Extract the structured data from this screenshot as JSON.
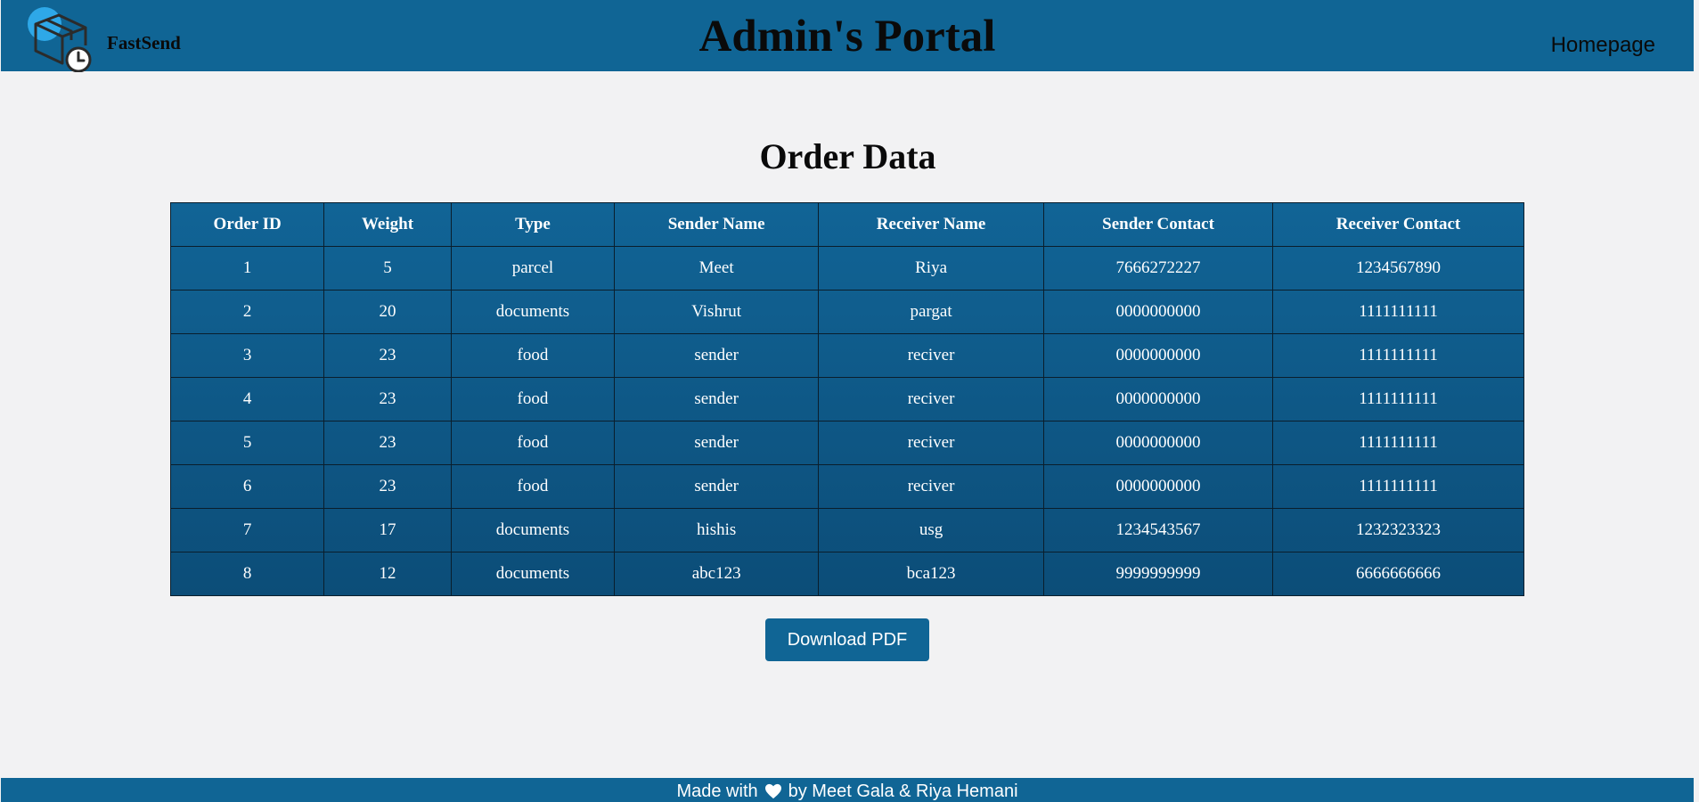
{
  "header": {
    "brand": "FastSend",
    "title": "Admin's Portal",
    "nav_link": "Homepage",
    "logo_icon": "package-clock-icon",
    "background": "#106595"
  },
  "main": {
    "section_title": "Order Data",
    "table": {
      "columns": [
        "Order ID",
        "Weight",
        "Type",
        "Sender Name",
        "Receiver Name",
        "Sender Contact",
        "Receiver Contact"
      ],
      "rows": [
        [
          "1",
          "5",
          "parcel",
          "Meet",
          "Riya",
          "7666272227",
          "1234567890"
        ],
        [
          "2",
          "20",
          "documents",
          "Vishrut",
          "pargat",
          "0000000000",
          "1111111111"
        ],
        [
          "3",
          "23",
          "food",
          "sender",
          "reciver",
          "0000000000",
          "1111111111"
        ],
        [
          "4",
          "23",
          "food",
          "sender",
          "reciver",
          "0000000000",
          "1111111111"
        ],
        [
          "5",
          "23",
          "food",
          "sender",
          "reciver",
          "0000000000",
          "1111111111"
        ],
        [
          "6",
          "23",
          "food",
          "sender",
          "reciver",
          "0000000000",
          "1111111111"
        ],
        [
          "7",
          "17",
          "documents",
          "hishis",
          "usg",
          "1234543567",
          "1232323323"
        ],
        [
          "8",
          "12",
          "documents",
          "abc123",
          "bca123",
          "9999999999",
          "6666666666"
        ]
      ]
    },
    "download_label": "Download PDF"
  },
  "footer": {
    "prefix": "Made with",
    "icon": "heart-icon",
    "suffix": "by Meet Gala & Riya Hemani"
  }
}
